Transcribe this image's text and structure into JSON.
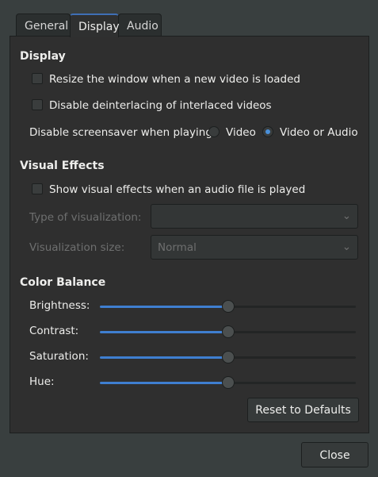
{
  "tabs": [
    {
      "label": "General"
    },
    {
      "label": "Display",
      "active": true
    },
    {
      "label": "Audio"
    }
  ],
  "display": {
    "heading": "Display",
    "resize_label": "Resize the window when a new video is loaded",
    "resize_checked": false,
    "deinterlace_label": "Disable deinterlacing of interlaced videos",
    "deinterlace_checked": false,
    "screensaver_label": "Disable screensaver when playing",
    "radio_video": "Video",
    "radio_video_or_audio": "Video or Audio",
    "screensaver_selected": "Video or Audio"
  },
  "visual": {
    "heading": "Visual Effects",
    "show_label": "Show visual effects when an audio file is played",
    "show_checked": false,
    "type_label": "Type of visualization:",
    "type_value": "",
    "size_label": "Visualization size:",
    "size_value": "Normal"
  },
  "color": {
    "heading": "Color Balance",
    "sliders": [
      {
        "label": "Brightness:",
        "value": 0.5
      },
      {
        "label": "Contrast:",
        "value": 0.5
      },
      {
        "label": "Saturation:",
        "value": 0.5
      },
      {
        "label": "Hue:",
        "value": 0.5
      }
    ],
    "reset_label": "Reset to Defaults"
  },
  "close_label": "Close",
  "colors": {
    "accent": "#4a90d9",
    "background": "#393f3f",
    "panel": "#2f2f2f"
  }
}
